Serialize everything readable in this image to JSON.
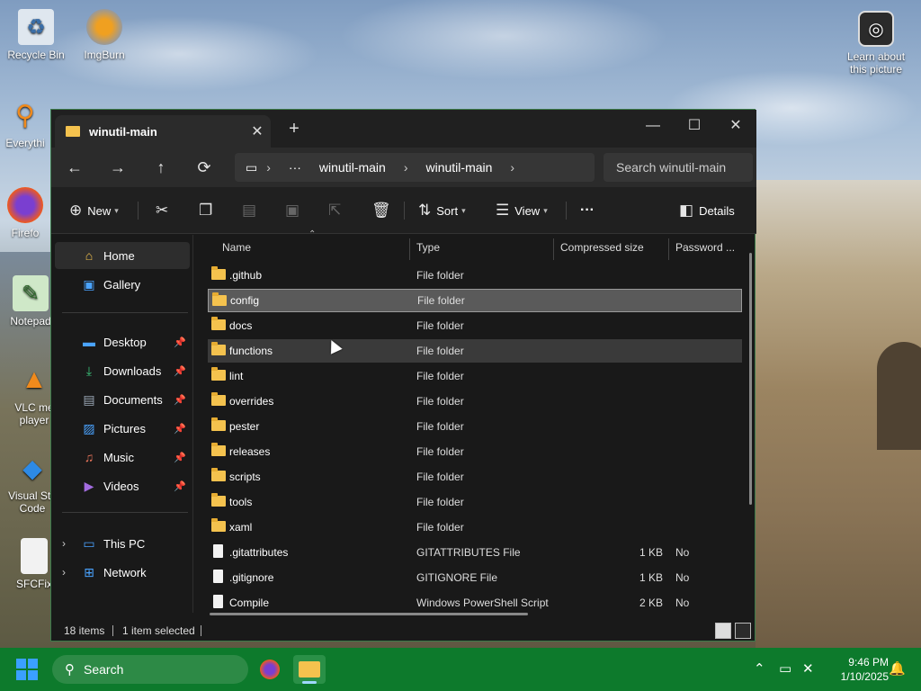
{
  "desktop": {
    "icons": [
      {
        "label": "Recycle Bin",
        "icon": "recycle-bin-icon"
      },
      {
        "label": "ImgBurn",
        "icon": "imgburn-icon"
      },
      {
        "label": "Everythi",
        "icon": "everything-search-icon"
      },
      {
        "label": "Firefo",
        "icon": "firefox-icon"
      },
      {
        "label": "Notepad",
        "icon": "notepad-icon"
      },
      {
        "label": "VLC me player",
        "icon": "vlc-icon"
      },
      {
        "label": "Visual Stu Code",
        "icon": "vscode-icon"
      },
      {
        "label": "SFCFix",
        "icon": "file-icon"
      }
    ],
    "learn_label": "Learn about this picture"
  },
  "window": {
    "tab_title": "winutil-main",
    "new_tab": "+",
    "controls": {
      "minimize": "—",
      "maximize": "☐",
      "close": "✕"
    }
  },
  "nav": {
    "back": "←",
    "forward": "→",
    "up": "↑",
    "refresh": "⟳",
    "breadcrumb": [
      "winutil-main",
      "winutil-main"
    ],
    "ellipsis": "···",
    "search_placeholder": "Search winutil-main"
  },
  "toolbar": {
    "new_label": "New",
    "sort_label": "Sort",
    "view_label": "View",
    "more_label": "···",
    "details_label": "Details"
  },
  "sidebar": {
    "top": [
      {
        "label": "Home",
        "icon": "home-icon"
      },
      {
        "label": "Gallery",
        "icon": "gallery-icon"
      }
    ],
    "pinned": [
      {
        "label": "Desktop",
        "icon": "desktop-icon"
      },
      {
        "label": "Downloads",
        "icon": "downloads-icon"
      },
      {
        "label": "Documents",
        "icon": "documents-icon"
      },
      {
        "label": "Pictures",
        "icon": "pictures-icon"
      },
      {
        "label": "Music",
        "icon": "music-icon"
      },
      {
        "label": "Videos",
        "icon": "videos-icon"
      }
    ],
    "drives": [
      {
        "label": "This PC",
        "icon": "this-pc-icon"
      },
      {
        "label": "Network",
        "icon": "network-icon"
      }
    ]
  },
  "columns": {
    "name": "Name",
    "type": "Type",
    "compressed": "Compressed size",
    "password": "Password ..."
  },
  "files": [
    {
      "name": ".github",
      "type": "File folder",
      "size": "",
      "password": "",
      "kind": "folder"
    },
    {
      "name": "config",
      "type": "File folder",
      "size": "",
      "password": "",
      "kind": "folder",
      "state": "selected"
    },
    {
      "name": "docs",
      "type": "File folder",
      "size": "",
      "password": "",
      "kind": "folder"
    },
    {
      "name": "functions",
      "type": "File folder",
      "size": "",
      "password": "",
      "kind": "folder",
      "state": "hover"
    },
    {
      "name": "lint",
      "type": "File folder",
      "size": "",
      "password": "",
      "kind": "folder"
    },
    {
      "name": "overrides",
      "type": "File folder",
      "size": "",
      "password": "",
      "kind": "folder"
    },
    {
      "name": "pester",
      "type": "File folder",
      "size": "",
      "password": "",
      "kind": "folder"
    },
    {
      "name": "releases",
      "type": "File folder",
      "size": "",
      "password": "",
      "kind": "folder"
    },
    {
      "name": "scripts",
      "type": "File folder",
      "size": "",
      "password": "",
      "kind": "folder"
    },
    {
      "name": "tools",
      "type": "File folder",
      "size": "",
      "password": "",
      "kind": "folder"
    },
    {
      "name": "xaml",
      "type": "File folder",
      "size": "",
      "password": "",
      "kind": "folder"
    },
    {
      "name": ".gitattributes",
      "type": "GITATTRIBUTES File",
      "size": "1 KB",
      "password": "No",
      "kind": "file"
    },
    {
      "name": ".gitignore",
      "type": "GITIGNORE File",
      "size": "1 KB",
      "password": "No",
      "kind": "file"
    },
    {
      "name": "Compile",
      "type": "Windows PowerShell Script",
      "size": "2 KB",
      "password": "No",
      "kind": "file"
    }
  ],
  "status": {
    "items": "18 items",
    "selected": "1 item selected"
  },
  "taskbar": {
    "search_label": "Search",
    "time": "9:46 PM",
    "date": "1/10/2025"
  }
}
